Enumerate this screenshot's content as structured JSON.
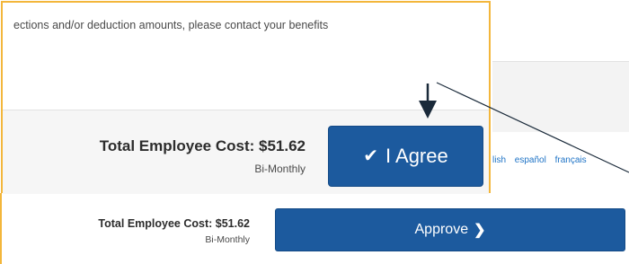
{
  "notice": {
    "text": "ections and/or deduction amounts, please contact your benefits"
  },
  "background": {
    "faded_text": "...... ...... ....",
    "languages": [
      "lish",
      "español",
      "français"
    ]
  },
  "callout": {
    "total_cost_label": "Total Employee Cost: $51.62",
    "frequency": "Bi-Monthly",
    "agree_button_label": "I Agree",
    "agree_icon": "check-icon"
  },
  "bottom": {
    "total_cost_label": "Total Employee Cost: $51.62",
    "frequency": "Bi-Monthly",
    "approve_button_label": "Approve",
    "approve_icon": "chevron-right-icon"
  },
  "colors": {
    "button_blue": "#1c5a9e",
    "highlight_border": "#f3b63b",
    "link_blue": "#1e73c6"
  }
}
